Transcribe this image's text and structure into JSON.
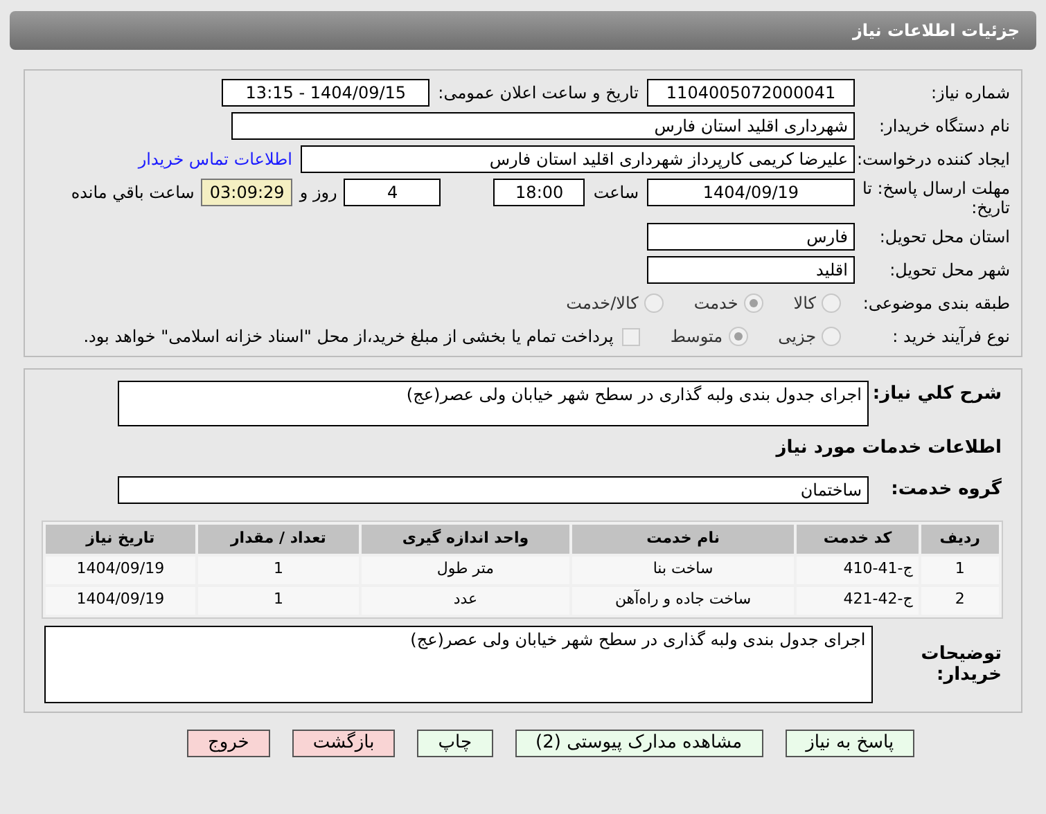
{
  "header": {
    "title": "جزئیات اطلاعات نیاز"
  },
  "fields": {
    "need_number": {
      "label": "شماره نیاز:",
      "value": "1104005072000041"
    },
    "announce": {
      "label": "تاریخ و ساعت اعلان عمومی:",
      "value": "1404/09/15 - 13:15"
    },
    "buyer": {
      "label": "نام دستگاه خریدار:",
      "value": "شهرداری اقلید استان فارس"
    },
    "creator": {
      "label": "ایجاد کننده درخواست:",
      "value": "علیرضا کریمی  کارپرداز شهرداری اقلید استان فارس",
      "link": "اطلاعات تماس خریدار"
    },
    "deadline": {
      "label": "مهلت ارسال پاسخ: تا تاریخ:",
      "date": "1404/09/19",
      "time_label": "ساعت",
      "time": "18:00",
      "days": "4",
      "days_label": "روز و",
      "remaining": "03:09:29",
      "remaining_label": "ساعت باقي مانده"
    },
    "province": {
      "label": "استان محل تحویل:",
      "value": "فارس"
    },
    "city": {
      "label": "شهر محل تحویل:",
      "value": "اقلید"
    }
  },
  "category": {
    "label": "طبقه بندی موضوعی:",
    "options": [
      {
        "label": "کالا",
        "selected": false
      },
      {
        "label": "خدمت",
        "selected": true
      },
      {
        "label": "کالا/خدمت",
        "selected": false
      }
    ]
  },
  "process": {
    "label": "نوع فرآیند خرید :",
    "options": [
      {
        "label": "جزیی",
        "selected": false
      },
      {
        "label": "متوسط",
        "selected": true
      }
    ],
    "payment": {
      "label": "پرداخت تمام یا بخشی از مبلغ خرید،از محل \"اسناد خزانه اسلامی\" خواهد بود.",
      "checked": false
    }
  },
  "description": {
    "label": "شرح کلي نیاز:",
    "value": "اجرای جدول بندی ولبه گذاری در  سطح شهر خیابان ولی عصر(عج)"
  },
  "services_title": "اطلاعات خدمات مورد نیاز",
  "service_group": {
    "label": "گروه خدمت:",
    "value": "ساختمان"
  },
  "table": {
    "columns": [
      "ردیف",
      "کد خدمت",
      "نام خدمت",
      "واحد اندازه گیری",
      "تعداد / مقدار",
      "تاریخ نیاز"
    ],
    "rows": [
      [
        "1",
        "ج-41-410",
        "ساخت بنا",
        "متر طول",
        "1",
        "1404/09/19"
      ],
      [
        "2",
        "ج-42-421",
        "ساخت جاده و راه‌آهن",
        "عدد",
        "1",
        "1404/09/19"
      ]
    ]
  },
  "buyer_notes": {
    "label": "توضیحات خریدار:",
    "value": "اجرای جدول بندی ولبه گذاری در  سطح شهر خیابان ولی عصر(عج)"
  },
  "buttons": [
    {
      "label": "پاسخ به نیاز",
      "kind": "normal"
    },
    {
      "label": "مشاهده مدارک پیوستی (2)",
      "kind": "normal"
    },
    {
      "label": "چاپ",
      "kind": "normal"
    },
    {
      "label": "بازگشت",
      "kind": "danger"
    },
    {
      "label": "خروج",
      "kind": "danger"
    }
  ]
}
